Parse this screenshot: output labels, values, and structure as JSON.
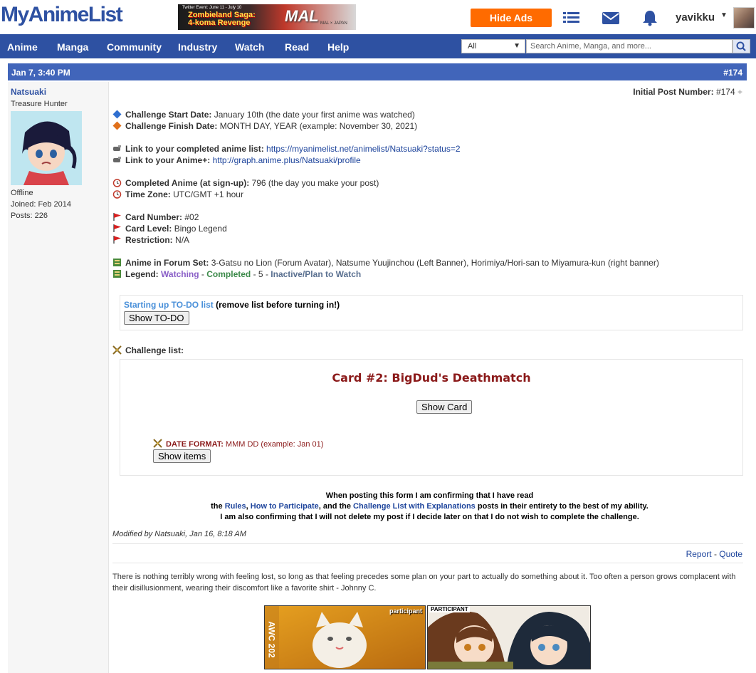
{
  "header": {
    "logo": "MyAnimeList",
    "ad_line1": "Twitter Event: June 11 - July 10",
    "ad_line2a": "Zombieland Saga:",
    "ad_line2b": "4-koma Revenge",
    "ad_brand": "MAL",
    "ad_sub": "MAL × JAPAN",
    "hide_ads": "Hide Ads",
    "username": "yavikku"
  },
  "nav": {
    "items": [
      "Anime",
      "Manga",
      "Community",
      "Industry",
      "Watch",
      "Read",
      "Help"
    ],
    "select_value": "All",
    "search_placeholder": "Search Anime, Manga, and more..."
  },
  "post": {
    "date": "Jan 7, 3:40 PM",
    "number": "#174",
    "initial_label": "Initial Post Number:",
    "initial_value": "#174",
    "user": {
      "name": "Natsuaki",
      "title": "Treasure Hunter",
      "status": "Offline",
      "joined": "Joined: Feb 2014",
      "posts": "Posts: 226"
    },
    "lines": {
      "start_label": "Challenge Start Date:",
      "start_value": "January 10th (the date your first anime was watched)",
      "finish_label": "Challenge Finish Date:",
      "finish_value": "MONTH DAY, YEAR (example: November 30, 2021)",
      "list_label": "Link to your completed anime list:",
      "list_url": "https://myanimelist.net/animelist/Natsuaki?status=2",
      "animeplus_label": "Link to your Anime+:",
      "animeplus_url": "http://graph.anime.plus/Natsuaki/profile",
      "completed_label": "Completed Anime (at sign-up):",
      "completed_value": "796 (the day you make your post)",
      "tz_label": "Time Zone:",
      "tz_value": "UTC/GMT +1 hour",
      "card_num_label": "Card Number:",
      "card_num_value": "#02",
      "card_level_label": "Card Level:",
      "card_level_value": "Bingo Legend",
      "restriction_label": "Restriction:",
      "restriction_value": "N/A",
      "forum_set_label": "Anime in Forum Set:",
      "forum_set_value": "3-Gatsu no Lion (Forum Avatar), Natsume Yuujinchou (Left Banner), Horimiya/Hori-san to Miyamura-kun (right banner)",
      "legend_label": "Legend:",
      "legend_watching": "Watching",
      "legend_sep1": " - ",
      "legend_completed": "Completed",
      "legend_sep2": " - 5 - ",
      "legend_inactive": "Inactive/Plan to Watch"
    },
    "todo": {
      "link": "Starting up TO-DO list",
      "note": "(remove list before turning in!)",
      "button": "Show TO-DO"
    },
    "challenge": {
      "label": "Challenge list:",
      "card_title": "Card #2: BigDud's Deathmatch",
      "show_card": "Show Card",
      "date_format_label": "DATE FORMAT:",
      "date_format_value": "MMM DD (example: Jan 01)",
      "show_items": "Show items"
    },
    "confirm": {
      "line1": "When posting this form I am confirming that I have read",
      "the": "the ",
      "rules": "Rules",
      "comma": ", ",
      "how": "How to Participate",
      "and_the": ", and the ",
      "challenge_list": "Challenge List with Explanations",
      "posts_tail": " posts in their entirety to the best of my ability.",
      "line3": "I am also confirming that I will not delete my post if I decide later on that I do not wish to complete the challenge."
    },
    "modified": "Modified by Natsuaki, Jan 16, 8:18 AM",
    "report": "Report",
    "report_sep": " - ",
    "quote": "Quote",
    "signature": "There is nothing terribly wrong with feeling lost, so long as that feeling precedes some plan on your part to actually do something about it. Too often a person grows complacent with their disillusionment, wearing their discomfort like a favorite shirt - Johnny C.",
    "sig_banner1_label": "participant",
    "sig_banner1_side": "AWC 202",
    "sig_banner2_label": "PARTICIPANT"
  }
}
